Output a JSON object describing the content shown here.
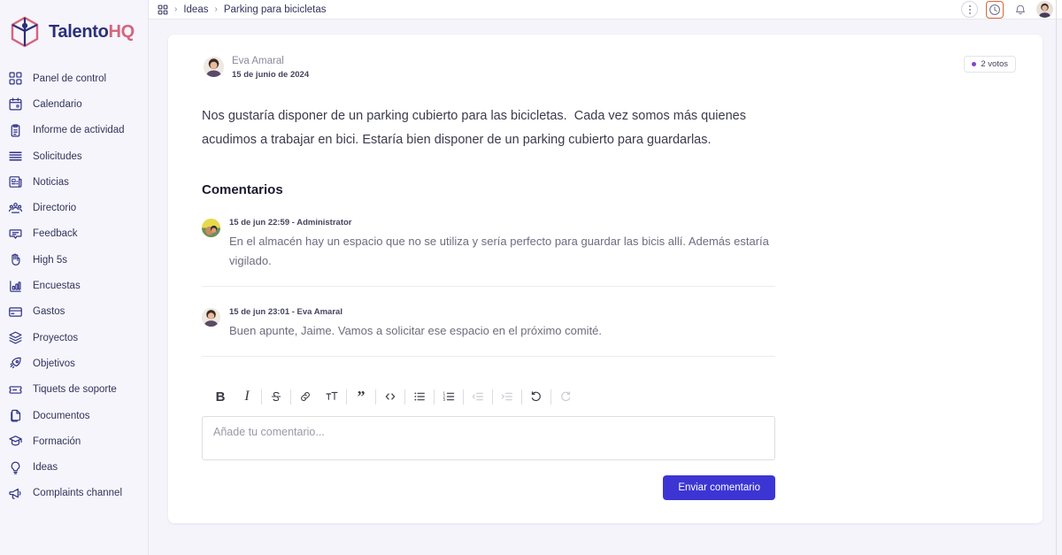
{
  "brand": {
    "name_primary": "Talento",
    "name_secondary": "HQ",
    "logo_icon": "cube-person-logo",
    "color_primary": "#2b2f7a",
    "color_secondary": "#d4657f"
  },
  "sidebar": {
    "items": [
      {
        "label": "Panel de control",
        "icon": "grid-dashboard-icon"
      },
      {
        "label": "Calendario",
        "icon": "calendar-icon"
      },
      {
        "label": "Informe de actividad",
        "icon": "clipboard-report-icon"
      },
      {
        "label": "Solicitudes",
        "icon": "stacked-lines-icon"
      },
      {
        "label": "Noticias",
        "icon": "newspaper-icon"
      },
      {
        "label": "Directorio",
        "icon": "people-group-icon"
      },
      {
        "label": "Feedback",
        "icon": "chat-bubble-icon"
      },
      {
        "label": "High 5s",
        "icon": "hand-icon"
      },
      {
        "label": "Encuestas",
        "icon": "bar-chart-icon"
      },
      {
        "label": "Gastos",
        "icon": "credit-card-icon"
      },
      {
        "label": "Proyectos",
        "icon": "layers-icon"
      },
      {
        "label": "Objetivos",
        "icon": "rocket-icon"
      },
      {
        "label": "Tiquets de soporte",
        "icon": "ticket-icon"
      },
      {
        "label": "Documentos",
        "icon": "documents-copy-icon"
      },
      {
        "label": "Formación",
        "icon": "graduation-cap-icon"
      },
      {
        "label": "Ideas",
        "icon": "lightbulb-icon"
      },
      {
        "label": "Complaints channel",
        "icon": "megaphone-icon"
      }
    ]
  },
  "topbar": {
    "apps_icon": "grid-apps-icon",
    "breadcrumb": {
      "separator": "›",
      "parent": "Ideas",
      "current": "Parking para bicicletas"
    },
    "actions": [
      {
        "name": "more-options",
        "icon": "kebab-menu-icon"
      },
      {
        "name": "history",
        "icon": "clock-history-icon",
        "focused": true,
        "focus_color": "#d9643a"
      },
      {
        "name": "notifications",
        "icon": "bell-icon"
      }
    ],
    "avatar_name": "user-avatar"
  },
  "post": {
    "author": "Eva Amaral",
    "date": "15 de junio de 2024",
    "votes_label": "2 votos",
    "votes_dot_color": "#8b3fd4",
    "body": "Nos gustaría disponer de un parking cubierto para las bicicletas.  Cada vez somos más quienes acudimos a trabajar en bici. Estaría bien disponer de un parking cubierto para guardarlas."
  },
  "comments_section": {
    "title": "Comentarios",
    "items": [
      {
        "meta": "15 de jun 22:59 - Administrator",
        "text": "En el almacén hay un espacio que no se utiliza y sería perfecto para guardar las bicis allí.  Además estaría vigilado."
      },
      {
        "meta": "15 de jun 23:01 - Eva Amaral",
        "text": "Buen apunte, Jaime.  Vamos a solicitar ese espacio en el próximo comité."
      }
    ]
  },
  "editor": {
    "toolbar": [
      {
        "name": "bold",
        "icon": "bold-icon",
        "glyph": "B",
        "disabled": false
      },
      {
        "name": "italic",
        "icon": "italic-icon",
        "glyph": "I",
        "disabled": false
      },
      {
        "sep": true
      },
      {
        "name": "strikethrough",
        "icon": "strikethrough-icon",
        "glyph": "S",
        "disabled": false
      },
      {
        "sep": true
      },
      {
        "name": "link",
        "icon": "link-icon",
        "glyph": "",
        "disabled": false
      },
      {
        "name": "text-size",
        "icon": "text-size-icon",
        "glyph": "",
        "disabled": false
      },
      {
        "sep": true
      },
      {
        "name": "blockquote",
        "icon": "quote-icon",
        "glyph": "",
        "disabled": false
      },
      {
        "sep": true
      },
      {
        "name": "code",
        "icon": "code-icon",
        "glyph": "",
        "disabled": false
      },
      {
        "sep": true
      },
      {
        "name": "bullet-list",
        "icon": "bullet-list-icon",
        "glyph": "",
        "disabled": false
      },
      {
        "sep": true
      },
      {
        "name": "numbered-list",
        "icon": "numbered-list-icon",
        "glyph": "",
        "disabled": false
      },
      {
        "sep": true
      },
      {
        "name": "outdent",
        "icon": "outdent-icon",
        "glyph": "",
        "disabled": true
      },
      {
        "sep": true
      },
      {
        "name": "indent",
        "icon": "indent-icon",
        "glyph": "",
        "disabled": true
      },
      {
        "sep": true
      },
      {
        "name": "undo",
        "icon": "undo-icon",
        "glyph": "",
        "disabled": false
      },
      {
        "sep": true
      },
      {
        "name": "redo",
        "icon": "redo-icon",
        "glyph": "",
        "disabled": true
      }
    ],
    "placeholder": "Añade tu comentario...",
    "value": "",
    "submit_label": "Enviar comentario",
    "submit_color": "#3c35d4"
  }
}
